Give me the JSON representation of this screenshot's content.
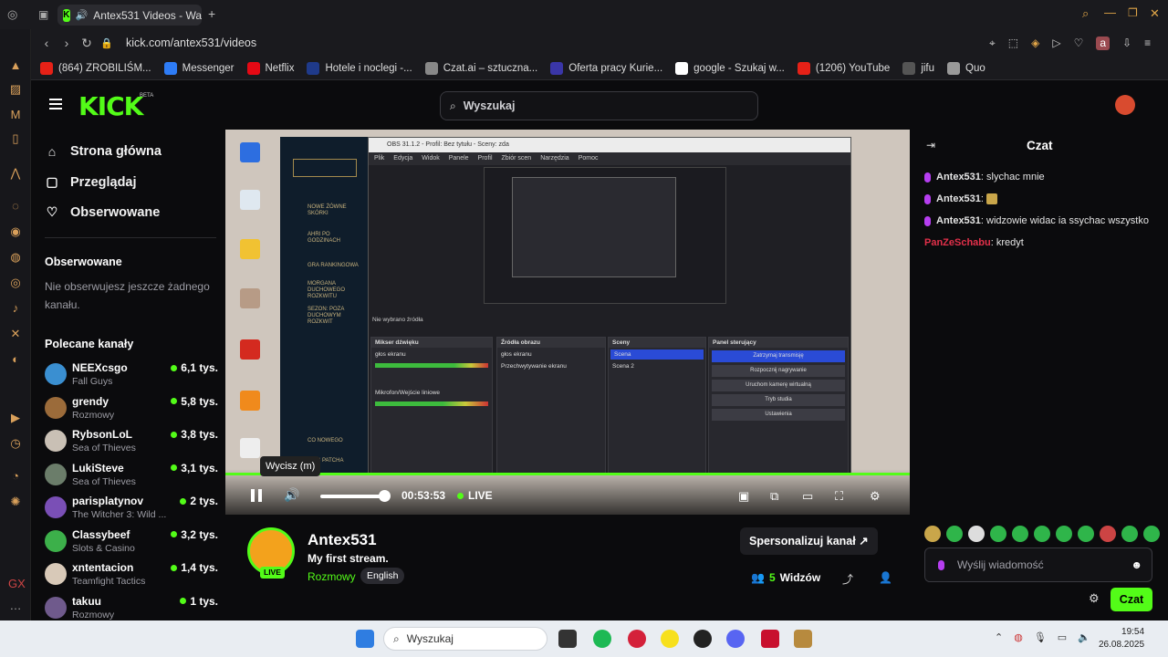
{
  "browser": {
    "tab_title": "Antex531 Videos - Wa",
    "url": "kick.com/antex531/videos",
    "bookmarks": [
      {
        "label": "(864) ZROBILIŚM...",
        "color": "#e62117"
      },
      {
        "label": "Messenger",
        "color": "#2e7cf6"
      },
      {
        "label": "Netflix",
        "color": "#e50914"
      },
      {
        "label": "Hotele i noclegi -...",
        "color": "#1f3a8a"
      },
      {
        "label": "Czat.ai – sztuczna...",
        "color": "#888888"
      },
      {
        "label": "Oferta pracy Kurie...",
        "color": "#3a36a8"
      },
      {
        "label": "google - Szukaj w...",
        "color": "#ffffff"
      },
      {
        "label": "(1206) YouTube",
        "color": "#e62117"
      },
      {
        "label": "jifu",
        "color": "#555555"
      },
      {
        "label": "Quo",
        "color": "#999999"
      }
    ]
  },
  "kick": {
    "logo": "KICK",
    "beta": "BETA",
    "search_placeholder": "Wyszukaj",
    "nav": [
      {
        "label": "Strona główna",
        "icon": "home-icon"
      },
      {
        "label": "Przeglądaj",
        "icon": "browse-icon"
      },
      {
        "label": "Obserwowane",
        "icon": "heart-icon"
      }
    ],
    "following_header": "Obserwowane",
    "following_empty": "Nie obserwujesz jeszcze żadnego kanału.",
    "recommended_header": "Polecane kanały",
    "channels": [
      {
        "name": "NEEXcsgo",
        "category": "Fall Guys",
        "viewers": "6,1 tys.",
        "color": "#3a8fd1"
      },
      {
        "name": "grendy",
        "category": "Rozmowy",
        "viewers": "5,8 tys.",
        "color": "#9b6b3a"
      },
      {
        "name": "RybsonLoL",
        "category": "Sea of Thieves",
        "viewers": "3,8 tys.",
        "color": "#c9c0b5"
      },
      {
        "name": "LukiSteve",
        "category": "Sea of Thieves",
        "viewers": "3,1 tys.",
        "color": "#6b7d6a"
      },
      {
        "name": "parisplatynov",
        "category": "The Witcher 3: Wild ...",
        "viewers": "2 tys.",
        "color": "#7a4fb6"
      },
      {
        "name": "Classybeef",
        "category": "Slots & Casino",
        "viewers": "3,2 tys.",
        "color": "#3cb04a"
      },
      {
        "name": "xntentacion",
        "category": "Teamfight Tactics",
        "viewers": "1,4 tys.",
        "color": "#d8c9b8"
      },
      {
        "name": "takuu",
        "category": "Rozmowy",
        "viewers": "1 tys.",
        "color": "#6f5a8c"
      }
    ]
  },
  "video": {
    "tooltip": "Wycisz (m)",
    "time": "00:53:53",
    "live": "LIVE",
    "volume_fraction": 0.92
  },
  "stream": {
    "name": "Antex531",
    "title": "My first stream.",
    "category": "Rozmowy",
    "language": "English",
    "live_badge": "LIVE",
    "customize": "Spersonalizuj kanał",
    "viewers_count": "5",
    "viewers_label": "Widzów"
  },
  "chat": {
    "title": "Czat",
    "messages": [
      {
        "user": "Antex531",
        "text": "slychac mnie",
        "color": "#e6e6e6",
        "mic": true
      },
      {
        "user": "Antex531",
        "text": "",
        "color": "#e6e6e6",
        "mic": true,
        "emote": true
      },
      {
        "user": "Antex531",
        "text": "widzowie widac ia ssychac wszystko",
        "color": "#e6e6e6",
        "mic": true
      },
      {
        "user": "PanZeSchabu",
        "text": "kredyt",
        "color": "#e3304a",
        "mic": false
      }
    ],
    "input_placeholder": "Wyślij wiadomość",
    "send_label": "Czat"
  },
  "taskbar": {
    "search": "Wyszukaj",
    "time": "19:54",
    "date": "26.08.2025"
  }
}
